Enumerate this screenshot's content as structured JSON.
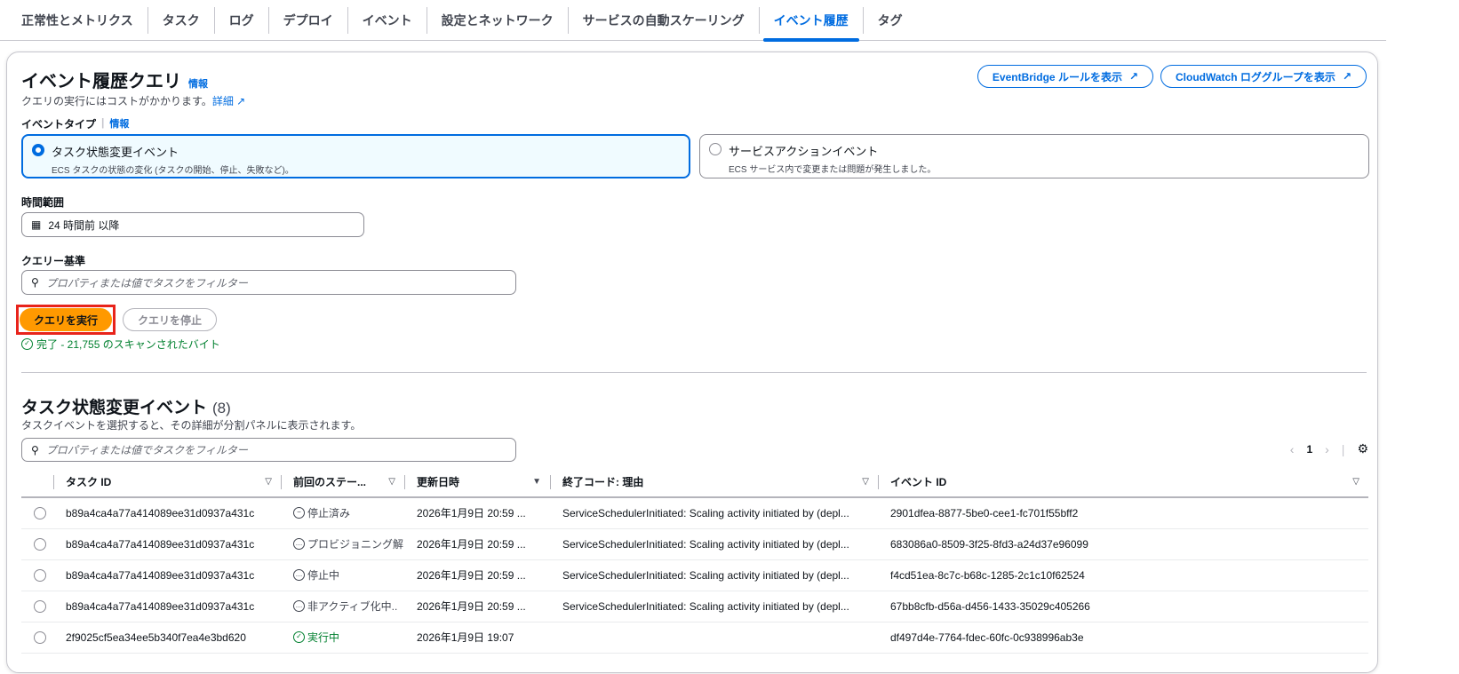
{
  "tabs": [
    "正常性とメトリクス",
    "タスク",
    "ログ",
    "デプロイ",
    "イベント",
    "設定とネットワーク",
    "サービスの自動スケーリング",
    "イベント履歴",
    "タグ"
  ],
  "active_tab": "イベント履歴",
  "query": {
    "title": "イベント履歴クエリ",
    "info": "情報",
    "cost_note": "クエリの実行にはコストがかかります。",
    "details_link": "詳細",
    "eventbridge_button": "EventBridge ルールを表示",
    "cloudwatch_button": "CloudWatch ロググループを表示",
    "event_type_label": "イベントタイプ",
    "event_type_info": "情報",
    "options": [
      {
        "title": "タスク状態変更イベント",
        "desc": "ECS タスクの状態の変化 (タスクの開始、停止、失敗など)。",
        "selected": true
      },
      {
        "title": "サービスアクションイベント",
        "desc": "ECS サービス内で変更または問題が発生しました。",
        "selected": false
      }
    ],
    "time_range_label": "時間範囲",
    "time_range_value": "24 時間前 以降",
    "criteria_label": "クエリー基準",
    "criteria_placeholder": "プロパティまたは値でタスクをフィルター",
    "run_button": "クエリを実行",
    "stop_button": "クエリを停止",
    "status": "完了 - 21,755 のスキャンされたバイト"
  },
  "results": {
    "title": "タスク状態変更イベント",
    "count": "(8)",
    "desc": "タスクイベントを選択すると、その詳細が分割パネルに表示されます。",
    "filter_placeholder": "プロパティまたは値でタスクをフィルター",
    "page": "1",
    "columns": [
      "タスク ID",
      "前回のステー...",
      "更新日時",
      "終了コード: 理由",
      "イベント ID"
    ],
    "rows": [
      {
        "task": "b89a4ca4a77a414089ee31d0937a431c",
        "status": "停止済み",
        "kind": "stopped",
        "date": "2026年1月9日 20:59 ...",
        "reason": "ServiceSchedulerInitiated: Scaling activity initiated by (depl...",
        "event": "2901dfea-8877-5be0-cee1-fc701f55bff2"
      },
      {
        "task": "b89a4ca4a77a414089ee31d0937a431c",
        "status": "プロビジョニング解",
        "kind": "pending",
        "date": "2026年1月9日 20:59 ...",
        "reason": "ServiceSchedulerInitiated: Scaling activity initiated by (depl...",
        "event": "683086a0-8509-3f25-8fd3-a24d37e96099"
      },
      {
        "task": "b89a4ca4a77a414089ee31d0937a431c",
        "status": "停止中",
        "kind": "pending",
        "date": "2026年1月9日 20:59 ...",
        "reason": "ServiceSchedulerInitiated: Scaling activity initiated by (depl...",
        "event": "f4cd51ea-8c7c-b68c-1285-2c1c10f62524"
      },
      {
        "task": "b89a4ca4a77a414089ee31d0937a431c",
        "status": "非アクティブ化中..",
        "kind": "pending",
        "date": "2026年1月9日 20:59 ...",
        "reason": "ServiceSchedulerInitiated: Scaling activity initiated by (depl...",
        "event": "67bb8cfb-d56a-d456-1433-35029c405266"
      },
      {
        "task": "2f9025cf5ea34ee5b340f7ea4e3bd620",
        "status": "実行中",
        "kind": "run",
        "date": "2026年1月9日 19:07",
        "reason": "",
        "event": "df497d4e-7764-fdec-60fc-0c938996ab3e"
      }
    ]
  },
  "colors": {
    "accent": "#006ce0",
    "primary_button": "#ff9900",
    "success": "#00802f",
    "highlight": "#e8231b"
  }
}
